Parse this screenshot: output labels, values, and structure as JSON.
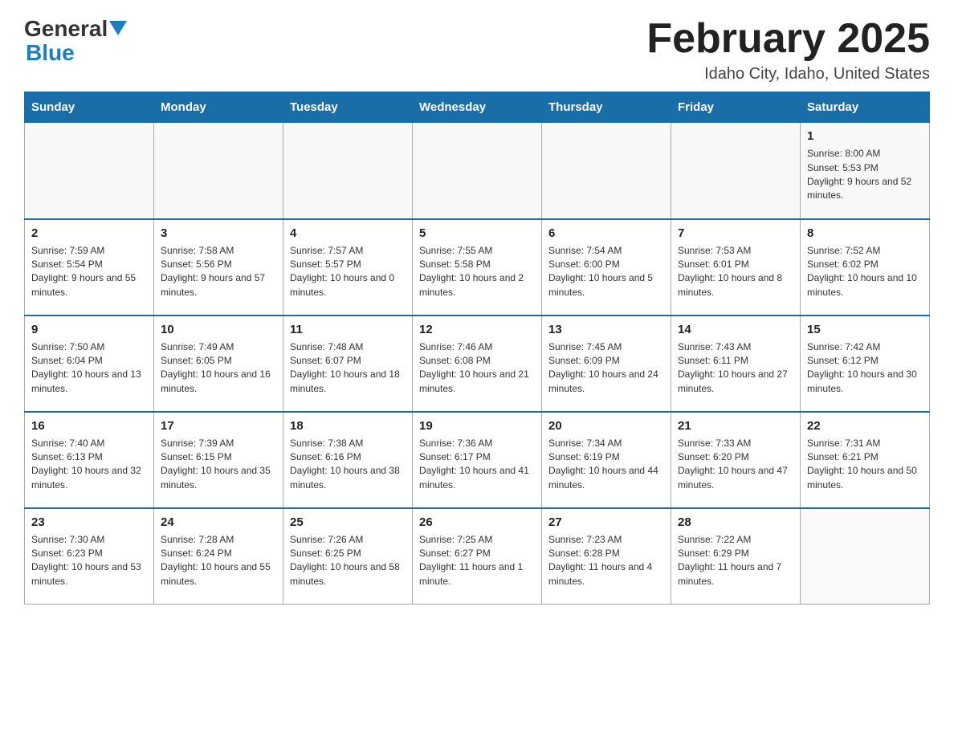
{
  "header": {
    "logo_general": "General",
    "logo_blue": "Blue",
    "title": "February 2025",
    "subtitle": "Idaho City, Idaho, United States"
  },
  "weekdays": [
    "Sunday",
    "Monday",
    "Tuesday",
    "Wednesday",
    "Thursday",
    "Friday",
    "Saturday"
  ],
  "weeks": [
    [
      {
        "day": "",
        "info": ""
      },
      {
        "day": "",
        "info": ""
      },
      {
        "day": "",
        "info": ""
      },
      {
        "day": "",
        "info": ""
      },
      {
        "day": "",
        "info": ""
      },
      {
        "day": "",
        "info": ""
      },
      {
        "day": "1",
        "info": "Sunrise: 8:00 AM\nSunset: 5:53 PM\nDaylight: 9 hours and 52 minutes."
      }
    ],
    [
      {
        "day": "2",
        "info": "Sunrise: 7:59 AM\nSunset: 5:54 PM\nDaylight: 9 hours and 55 minutes."
      },
      {
        "day": "3",
        "info": "Sunrise: 7:58 AM\nSunset: 5:56 PM\nDaylight: 9 hours and 57 minutes."
      },
      {
        "day": "4",
        "info": "Sunrise: 7:57 AM\nSunset: 5:57 PM\nDaylight: 10 hours and 0 minutes."
      },
      {
        "day": "5",
        "info": "Sunrise: 7:55 AM\nSunset: 5:58 PM\nDaylight: 10 hours and 2 minutes."
      },
      {
        "day": "6",
        "info": "Sunrise: 7:54 AM\nSunset: 6:00 PM\nDaylight: 10 hours and 5 minutes."
      },
      {
        "day": "7",
        "info": "Sunrise: 7:53 AM\nSunset: 6:01 PM\nDaylight: 10 hours and 8 minutes."
      },
      {
        "day": "8",
        "info": "Sunrise: 7:52 AM\nSunset: 6:02 PM\nDaylight: 10 hours and 10 minutes."
      }
    ],
    [
      {
        "day": "9",
        "info": "Sunrise: 7:50 AM\nSunset: 6:04 PM\nDaylight: 10 hours and 13 minutes."
      },
      {
        "day": "10",
        "info": "Sunrise: 7:49 AM\nSunset: 6:05 PM\nDaylight: 10 hours and 16 minutes."
      },
      {
        "day": "11",
        "info": "Sunrise: 7:48 AM\nSunset: 6:07 PM\nDaylight: 10 hours and 18 minutes."
      },
      {
        "day": "12",
        "info": "Sunrise: 7:46 AM\nSunset: 6:08 PM\nDaylight: 10 hours and 21 minutes."
      },
      {
        "day": "13",
        "info": "Sunrise: 7:45 AM\nSunset: 6:09 PM\nDaylight: 10 hours and 24 minutes."
      },
      {
        "day": "14",
        "info": "Sunrise: 7:43 AM\nSunset: 6:11 PM\nDaylight: 10 hours and 27 minutes."
      },
      {
        "day": "15",
        "info": "Sunrise: 7:42 AM\nSunset: 6:12 PM\nDaylight: 10 hours and 30 minutes."
      }
    ],
    [
      {
        "day": "16",
        "info": "Sunrise: 7:40 AM\nSunset: 6:13 PM\nDaylight: 10 hours and 32 minutes."
      },
      {
        "day": "17",
        "info": "Sunrise: 7:39 AM\nSunset: 6:15 PM\nDaylight: 10 hours and 35 minutes."
      },
      {
        "day": "18",
        "info": "Sunrise: 7:38 AM\nSunset: 6:16 PM\nDaylight: 10 hours and 38 minutes."
      },
      {
        "day": "19",
        "info": "Sunrise: 7:36 AM\nSunset: 6:17 PM\nDaylight: 10 hours and 41 minutes."
      },
      {
        "day": "20",
        "info": "Sunrise: 7:34 AM\nSunset: 6:19 PM\nDaylight: 10 hours and 44 minutes."
      },
      {
        "day": "21",
        "info": "Sunrise: 7:33 AM\nSunset: 6:20 PM\nDaylight: 10 hours and 47 minutes."
      },
      {
        "day": "22",
        "info": "Sunrise: 7:31 AM\nSunset: 6:21 PM\nDaylight: 10 hours and 50 minutes."
      }
    ],
    [
      {
        "day": "23",
        "info": "Sunrise: 7:30 AM\nSunset: 6:23 PM\nDaylight: 10 hours and 53 minutes."
      },
      {
        "day": "24",
        "info": "Sunrise: 7:28 AM\nSunset: 6:24 PM\nDaylight: 10 hours and 55 minutes."
      },
      {
        "day": "25",
        "info": "Sunrise: 7:26 AM\nSunset: 6:25 PM\nDaylight: 10 hours and 58 minutes."
      },
      {
        "day": "26",
        "info": "Sunrise: 7:25 AM\nSunset: 6:27 PM\nDaylight: 11 hours and 1 minute."
      },
      {
        "day": "27",
        "info": "Sunrise: 7:23 AM\nSunset: 6:28 PM\nDaylight: 11 hours and 4 minutes."
      },
      {
        "day": "28",
        "info": "Sunrise: 7:22 AM\nSunset: 6:29 PM\nDaylight: 11 hours and 7 minutes."
      },
      {
        "day": "",
        "info": ""
      }
    ]
  ]
}
